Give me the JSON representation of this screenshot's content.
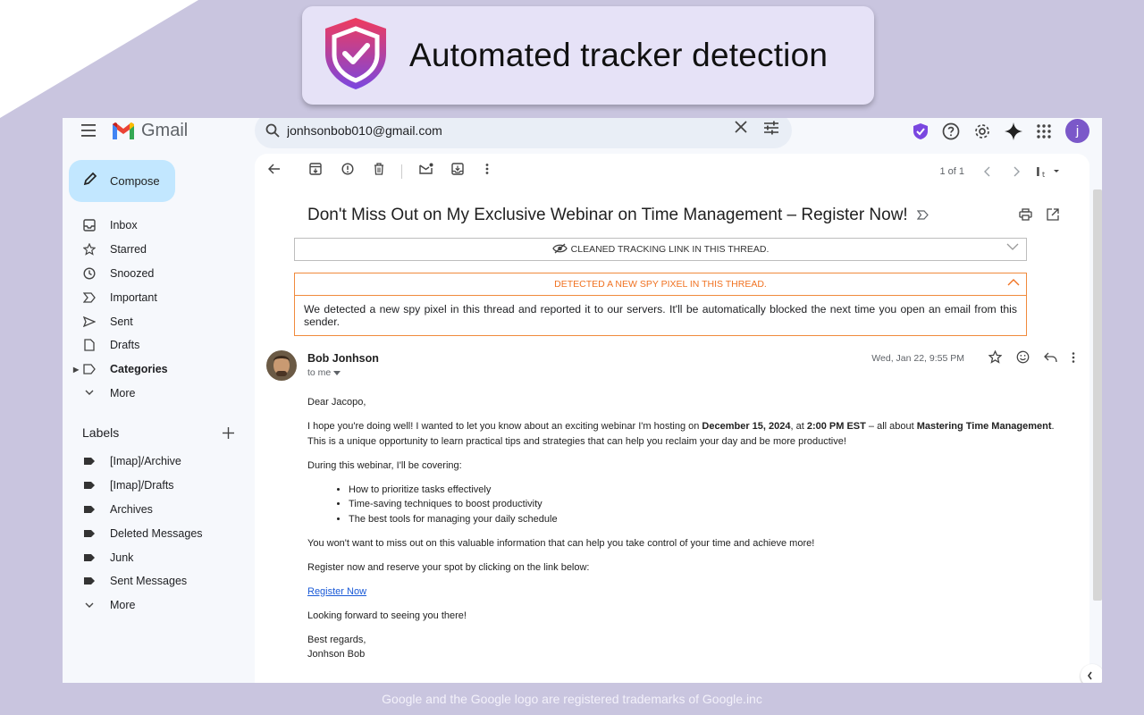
{
  "banner": {
    "title": "Automated tracker detection"
  },
  "gmail": {
    "logo_text": "Gmail",
    "search": {
      "value": "jonhsonbob010@gmail.com"
    },
    "avatar_letter": "j",
    "compose_label": "Compose",
    "nav": [
      {
        "label": "Inbox",
        "icon": "inbox-icon"
      },
      {
        "label": "Starred",
        "icon": "star-icon"
      },
      {
        "label": "Snoozed",
        "icon": "clock-icon"
      },
      {
        "label": "Important",
        "icon": "important-icon"
      },
      {
        "label": "Sent",
        "icon": "send-icon"
      },
      {
        "label": "Drafts",
        "icon": "draft-icon"
      },
      {
        "label": "Categories",
        "icon": "label-outline-icon"
      },
      {
        "label": "More",
        "icon": "chevron-down-icon"
      }
    ],
    "labels_title": "Labels",
    "labels": [
      {
        "label": "[Imap]/Archive"
      },
      {
        "label": "[Imap]/Drafts"
      },
      {
        "label": "Archives"
      },
      {
        "label": "Deleted Messages"
      },
      {
        "label": "Junk"
      },
      {
        "label": "Sent Messages"
      },
      {
        "label": "More"
      }
    ],
    "pager": "1 of 1",
    "subject": "Don't Miss Out on My Exclusive Webinar on Time Management – Register Now!",
    "tracker_notice": "CLEANED TRACKING LINK IN THIS THREAD.",
    "pixel_notice": {
      "title": "DETECTED A NEW SPY PIXEL IN THIS THREAD.",
      "body": "We detected a new spy pixel in this thread and reported it to our servers. It'll be automatically blocked the next time you open an email from this sender."
    },
    "message": {
      "sender": "Bob Jonhson",
      "to": "to me",
      "date": "Wed, Jan 22, 9:55 PM",
      "greeting": "Dear Jacopo,",
      "p1_a": "I hope you're doing well! I wanted to let you know about an exciting webinar I'm hosting on ",
      "p1_date": "December 15, 2024",
      "p1_b": ", at ",
      "p1_time": "2:00 PM EST",
      "p1_c": " – all about ",
      "p1_topic": "Mastering Time Management",
      "p1_d": ". This is a unique opportunity to learn practical tips and strategies that can help you reclaim your day and be more productive!",
      "p2": "During this webinar, I'll be covering:",
      "bullets": [
        "How to prioritize tasks effectively",
        "Time-saving techniques to boost productivity",
        "The best tools for managing your daily schedule"
      ],
      "p3": "You won't want to miss out on this valuable information that can help you take control of your time and achieve more!",
      "p4": "Register now and reserve your spot by clicking on the link below:",
      "link": "Register Now",
      "p5": "Looking forward to seeing you there!",
      "signoff": "Best regards,",
      "signature": "Jonhson Bob"
    }
  },
  "footer": "Google and the Google logo are registered trademarks of Google.inc",
  "colors": {
    "accent": "#7b58c9",
    "compose": "#c2e7ff",
    "warning": "#f07222",
    "link": "#1a5ad7"
  }
}
